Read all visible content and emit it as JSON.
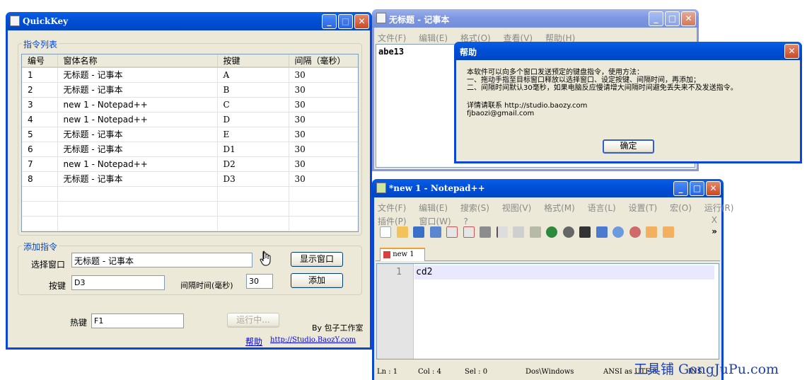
{
  "quickkey": {
    "title": "QuickKey",
    "list_group": "指令列表",
    "columns": [
      "编号",
      "窗体名称",
      "按键",
      "间隔（毫秒）"
    ],
    "rows": [
      [
        "1",
        "无标题 - 记事本",
        "A",
        "30"
      ],
      [
        "2",
        "无标题 - 记事本",
        "B",
        "30"
      ],
      [
        "3",
        "new  1 - Notepad++",
        "C",
        "30"
      ],
      [
        "4",
        "new  1 - Notepad++",
        "D",
        "30"
      ],
      [
        "5",
        "无标题 - 记事本",
        "E",
        "30"
      ],
      [
        "6",
        "无标题 - 记事本",
        "D1",
        "30"
      ],
      [
        "7",
        "new  1 - Notepad++",
        "D2",
        "30"
      ],
      [
        "8",
        "无标题 - 记事本",
        "D3",
        "30"
      ]
    ],
    "add_group": "添加指令",
    "select_window_label": "选择窗口",
    "select_window_value": "无标题 - 记事本",
    "show_window_button": "显示窗口",
    "key_label": "按键",
    "key_value": "D3",
    "interval_label": "间隔时间(毫秒)",
    "interval_value": "30",
    "add_button": "添加",
    "hotkey_label": "热键",
    "hotkey_value": "F1",
    "running_button": "运行中...",
    "credit": "By 包子工作室",
    "help_link": "帮助",
    "site_link": "http://Studio.BaozY.com"
  },
  "notepad": {
    "title": "无标题 - 记事本",
    "menu": [
      "文件(F)",
      "编辑(E)",
      "格式(O)",
      "查看(V)",
      "帮助(H)"
    ],
    "content": "abe13"
  },
  "help_dialog": {
    "title": "帮助",
    "lines": [
      "本软件可以向多个窗口发送预定的键盘指令，使用方法：",
      "一、拖动手指至目标窗口释放以选择窗口、设定按键、间隔时间，再添加；",
      "二、间隔时间默认30毫秒，如果电脑反应慢请增大间隔时间避免丢失来不及发送指令。"
    ],
    "contact_line": "详情请联系 http://studio.baozy.com",
    "email_line": "fjbaozi@gmail.com",
    "ok_button": "确定"
  },
  "notepadpp": {
    "title": "*new  1 - Notepad++",
    "menu_row1": [
      "文件(F)",
      "编辑(E)",
      "搜索(S)",
      "视图(V)",
      "格式(M)",
      "语言(L)",
      "设置(T)",
      "宏(O)",
      "运行(R)"
    ],
    "menu_row2": [
      "插件(P)",
      "窗口(W)",
      "?"
    ],
    "menu_close": "X",
    "toolbar_more": "»",
    "tab_label": "new  1",
    "line_number": "1",
    "line_text": "cd2",
    "status": [
      "Ln : 1",
      "Col : 4",
      "Sel : 0",
      "Dos\\Windows",
      "ANSI as UTF-8",
      "INS"
    ]
  },
  "watermark": "工具铺 GongJuPu.com"
}
